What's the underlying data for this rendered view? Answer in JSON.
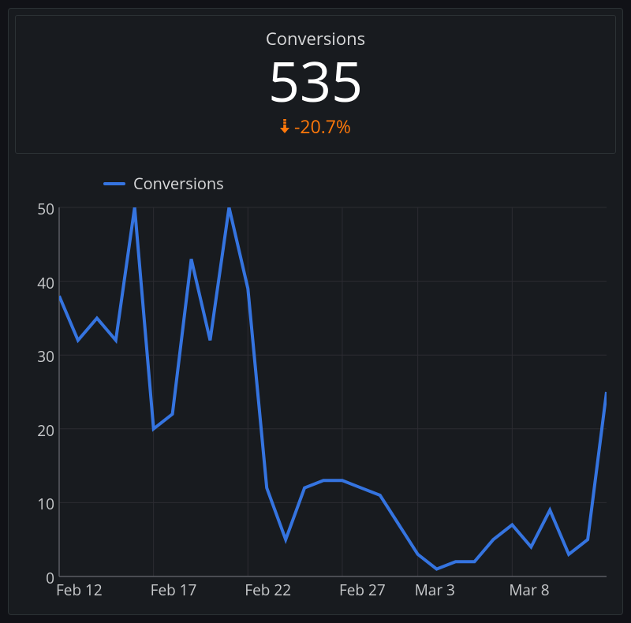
{
  "header": {
    "title": "Conversions",
    "metric_value": "535",
    "delta_text": "-20.7%",
    "delta_direction": "down",
    "delta_color": "#ff780a"
  },
  "legend": {
    "series_name": "Conversions",
    "series_color": "#3574e0"
  },
  "axes": {
    "y_ticks": [
      "0",
      "10",
      "20",
      "30",
      "40",
      "50"
    ],
    "x_ticks": [
      "Feb 12",
      "Feb 17",
      "Feb 22",
      "Feb 27",
      "Mar 3",
      "Mar 8"
    ]
  },
  "chart_data": {
    "type": "line",
    "title": "Conversions",
    "xlabel": "",
    "ylabel": "",
    "ylim": [
      0,
      50
    ],
    "x": [
      "Feb 12",
      "Feb 13",
      "Feb 14",
      "Feb 15",
      "Feb 16",
      "Feb 17",
      "Feb 18",
      "Feb 19",
      "Feb 20",
      "Feb 21",
      "Feb 22",
      "Feb 23",
      "Feb 24",
      "Feb 25",
      "Feb 26",
      "Feb 27",
      "Feb 28",
      "Mar 1",
      "Mar 2",
      "Mar 3",
      "Mar 4",
      "Mar 5",
      "Mar 6",
      "Mar 7",
      "Mar 8",
      "Mar 9",
      "Mar 10",
      "Mar 11",
      "Mar 12"
    ],
    "series": [
      {
        "name": "Conversions",
        "color": "#3574e0",
        "values": [
          38,
          32,
          35,
          32,
          50,
          20,
          22,
          43,
          32,
          50,
          39,
          12,
          5,
          12,
          13,
          13,
          12,
          11,
          7,
          3,
          1,
          2,
          2,
          5,
          7,
          4,
          9,
          3,
          5,
          25
        ]
      }
    ],
    "legend_position": "top-left",
    "grid": true
  }
}
